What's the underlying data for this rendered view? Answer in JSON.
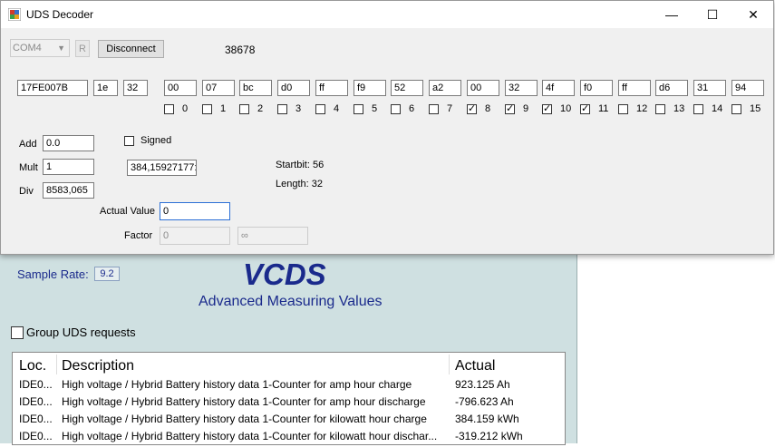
{
  "uds_window": {
    "title": "UDS Decoder",
    "controls": {
      "minimize": "—",
      "maximize": "☐",
      "close": "✕"
    },
    "com_port": "COM4",
    "r_button": "R",
    "disconnect_button": "Disconnect",
    "counter": "38678",
    "header_fields": [
      "17FE007B",
      "1e",
      "32"
    ],
    "bytes": [
      "00",
      "07",
      "bc",
      "d0",
      "ff",
      "f9",
      "52",
      "a2",
      "00",
      "32",
      "4f",
      "f0",
      "ff",
      "d6",
      "31",
      "94"
    ],
    "bit_checkboxes": [
      {
        "label": "0",
        "checked": false
      },
      {
        "label": "1",
        "checked": false
      },
      {
        "label": "2",
        "checked": false
      },
      {
        "label": "3",
        "checked": false
      },
      {
        "label": "4",
        "checked": false
      },
      {
        "label": "5",
        "checked": false
      },
      {
        "label": "6",
        "checked": false
      },
      {
        "label": "7",
        "checked": false
      },
      {
        "label": "8",
        "checked": true
      },
      {
        "label": "9",
        "checked": true
      },
      {
        "label": "10",
        "checked": true
      },
      {
        "label": "11",
        "checked": true
      },
      {
        "label": "12",
        "checked": false
      },
      {
        "label": "13",
        "checked": false
      },
      {
        "label": "14",
        "checked": false
      },
      {
        "label": "15",
        "checked": false
      }
    ],
    "add_label": "Add",
    "add_value": "0.0",
    "mult_label": "Mult",
    "mult_value": "1",
    "div_label": "Div",
    "div_value": "8583,065",
    "signed_label": "Signed",
    "signed_checked": false,
    "result_value": "384,15927177:",
    "startbit": "Startbit: 56",
    "length": "Length: 32",
    "actual_value_label": "Actual Value",
    "actual_value": "0",
    "factor_label": "Factor",
    "factor_value": "0",
    "factor_result": "∞"
  },
  "vcds": {
    "sample_rate_label": "Sample Rate:",
    "sample_rate_value": "9.2",
    "title": "VCDS",
    "subtitle": "Advanced Measuring Values",
    "group_label": "Group UDS requests",
    "columns": {
      "loc": "Loc.",
      "description": "Description",
      "actual": "Actual"
    },
    "rows": [
      {
        "loc": "IDE0...",
        "description": "High voltage / Hybrid Battery history data 1-Counter for amp hour charge",
        "actual": "923.125 Ah"
      },
      {
        "loc": "IDE0...",
        "description": "High voltage / Hybrid Battery history data 1-Counter for amp hour discharge",
        "actual": "-796.623 Ah"
      },
      {
        "loc": "IDE0...",
        "description": "High voltage / Hybrid Battery history data 1-Counter for kilowatt hour charge",
        "actual": "384.159 kWh"
      },
      {
        "loc": "IDE0...",
        "description": "High voltage / Hybrid Battery history data 1-Counter for kilowatt hour dischar...",
        "actual": "-319.212 kWh"
      }
    ]
  }
}
